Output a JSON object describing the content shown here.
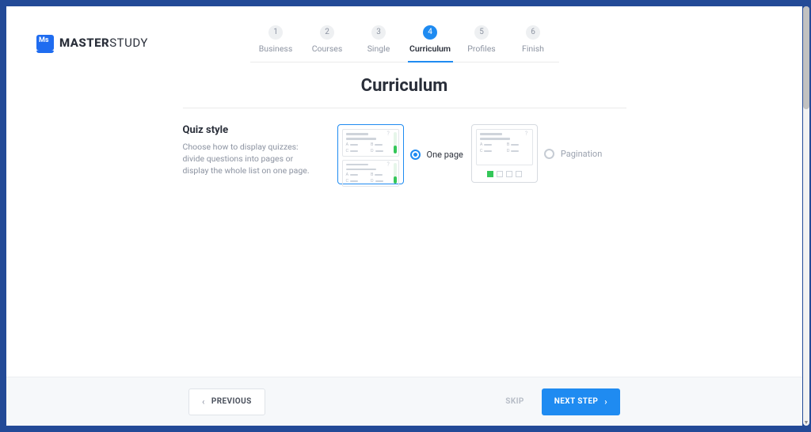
{
  "brand": {
    "strong": "MASTER",
    "light": "STUDY",
    "badge": "Ms"
  },
  "steps": [
    {
      "num": "1",
      "label": "Business"
    },
    {
      "num": "2",
      "label": "Courses"
    },
    {
      "num": "3",
      "label": "Single"
    },
    {
      "num": "4",
      "label": "Curriculum"
    },
    {
      "num": "5",
      "label": "Profiles"
    },
    {
      "num": "6",
      "label": "Finish"
    }
  ],
  "active_step_index": 3,
  "title": "Curriculum",
  "section": {
    "heading": "Quiz style",
    "description": "Choose how to display quizzes: divide questions into pages or display the whole list on one page."
  },
  "options": {
    "one_page": {
      "label": "One page",
      "selected": true
    },
    "pagination": {
      "label": "Pagination",
      "selected": false
    }
  },
  "footer": {
    "previous": "PREVIOUS",
    "skip": "SKIP",
    "next": "NEXT STEP"
  },
  "quiz_letters": [
    "A",
    "B",
    "C",
    "D"
  ]
}
